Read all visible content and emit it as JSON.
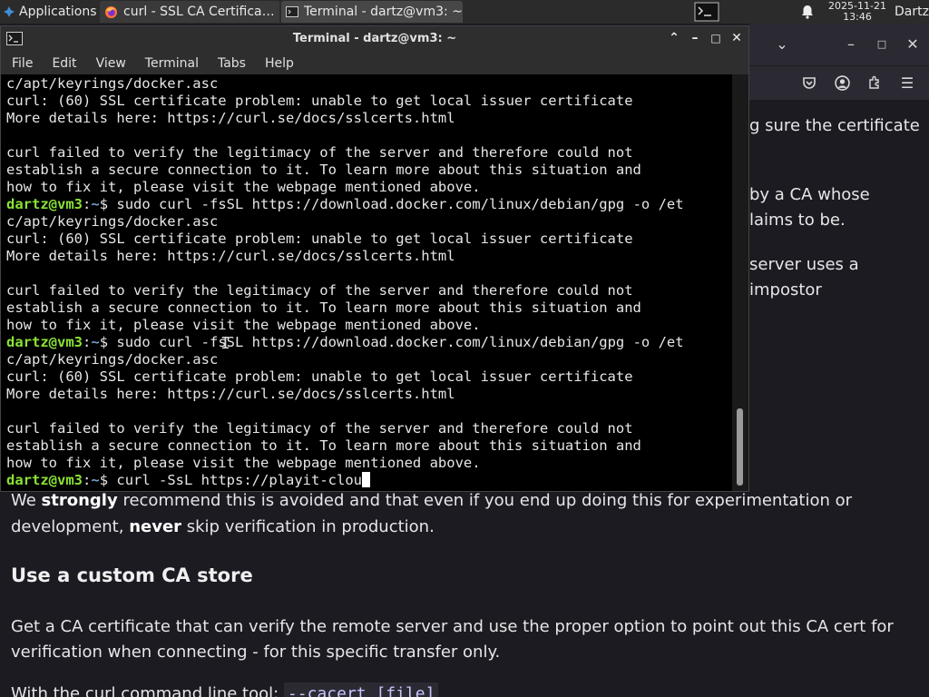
{
  "taskbar": {
    "apps_label": "Applications",
    "tasks": [
      {
        "label": "curl - SSL CA Certificate...",
        "icon": "firefox-icon"
      },
      {
        "label": "Terminal - dartz@vm3: ~",
        "icon": "terminal-icon"
      }
    ],
    "clock_date": "2025-11-21",
    "clock_time": "13:46",
    "user": "Dartz"
  },
  "terminal": {
    "title": "Terminal - dartz@vm3: ~",
    "menu": [
      "File",
      "Edit",
      "View",
      "Terminal",
      "Tabs",
      "Help"
    ],
    "lines": [
      {
        "text": "c/apt/keyrings/docker.asc"
      },
      {
        "text": "curl: (60) SSL certificate problem: unable to get local issuer certificate"
      },
      {
        "text": "More details here: https://curl.se/docs/sslcerts.html"
      },
      {
        "text": ""
      },
      {
        "text": "curl failed to verify the legitimacy of the server and therefore could not"
      },
      {
        "text": "establish a secure connection to it. To learn more about this situation and"
      },
      {
        "text": "how to fix it, please visit the webpage mentioned above."
      },
      {
        "prompt": true,
        "text": "sudo curl -fsSL https://download.docker.com/linux/debian/gpg -o /et"
      },
      {
        "text": "c/apt/keyrings/docker.asc"
      },
      {
        "text": "curl: (60) SSL certificate problem: unable to get local issuer certificate"
      },
      {
        "text": "More details here: https://curl.se/docs/sslcerts.html"
      },
      {
        "text": ""
      },
      {
        "text": "curl failed to verify the legitimacy of the server and therefore could not"
      },
      {
        "text": "establish a secure connection to it. To learn more about this situation and"
      },
      {
        "text": "how to fix it, please visit the webpage mentioned above."
      },
      {
        "prompt": true,
        "text": "sudo curl -fsSL https://download.docker.com/linux/debian/gpg -o /et"
      },
      {
        "text": "c/apt/keyrings/docker.asc"
      },
      {
        "text": "curl: (60) SSL certificate problem: unable to get local issuer certificate"
      },
      {
        "text": "More details here: https://curl.se/docs/sslcerts.html"
      },
      {
        "text": ""
      },
      {
        "text": "curl failed to verify the legitimacy of the server and therefore could not"
      },
      {
        "text": "establish a secure connection to it. To learn more about this situation and"
      },
      {
        "text": "how to fix it, please visit the webpage mentioned above."
      },
      {
        "prompt": true,
        "text": "curl -SsL https://playit-clou",
        "cursor": true
      }
    ],
    "prompt_user": "dartz@vm3",
    "prompt_path": "~",
    "prompt_suffix": "$ ",
    "scroll_thumb_fraction": 0.19,
    "scroll_position_fraction": 0.81
  },
  "page": {
    "right_fragments": [
      "g sure the certificate",
      "by a CA whose",
      "laims to be.",
      "server uses a",
      "impostor"
    ],
    "para1_a": "We ",
    "para1_b": "strongly",
    "para1_c": " recommend this is avoided and that even if you end up doing this for experimentation or",
    "para1_line2_b": "never",
    "para1_line2_a": "development, ",
    "para1_line2_c": " skip verification in production.",
    "heading": "Use a custom CA store",
    "para2_line1": "Get a CA certificate that can verify the remote server and use the proper option to point out this CA cert for",
    "para2_line2": "verification when connecting - for this specific transfer only.",
    "para3_text": "With the curl command line tool: ",
    "para3_code": "--cacert [file]"
  },
  "colors": {
    "prompt_green": "#8ae234",
    "prompt_blue": "#729fcf",
    "page_bg": "#1c1b22"
  }
}
